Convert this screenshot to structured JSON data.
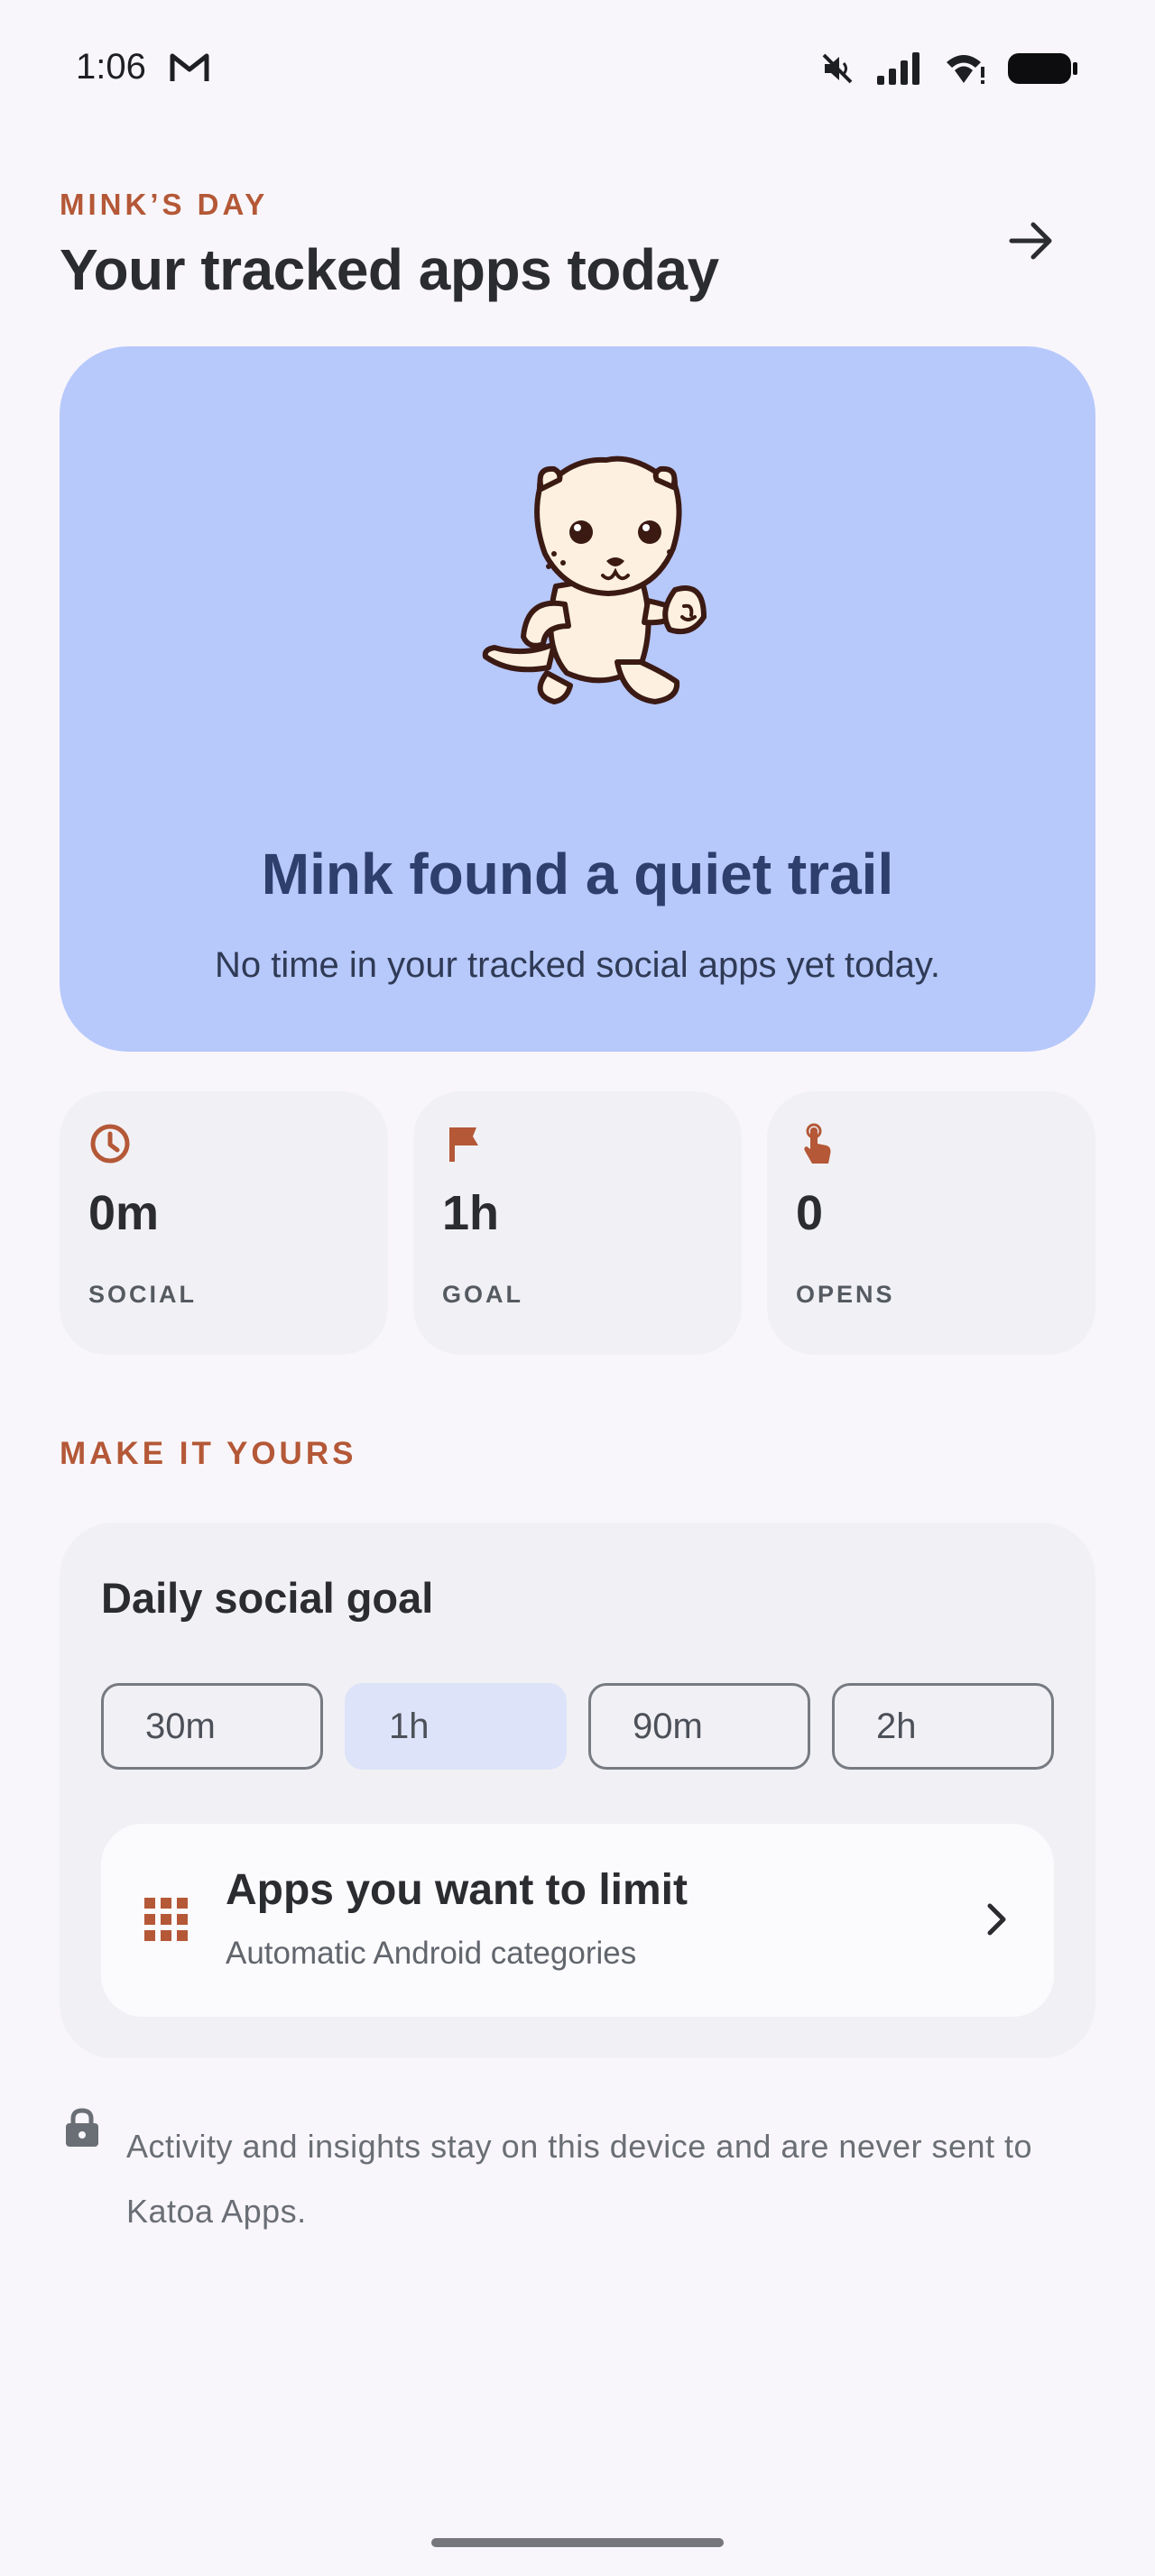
{
  "status_bar": {
    "time": "1:06",
    "icons": [
      "gmail-icon",
      "mute-icon",
      "signal-icon",
      "wifi-icon",
      "battery-icon"
    ]
  },
  "header": {
    "eyebrow": "MINK’S DAY",
    "title": "Your tracked apps today",
    "next_icon": "arrow-right-icon"
  },
  "hero": {
    "title": "Mink found a quiet trail",
    "subtitle": "No time in your tracked social apps yet today.",
    "background": "#b7c8fb"
  },
  "stats": [
    {
      "icon": "clock-icon",
      "value": "0m",
      "label": "SOCIAL"
    },
    {
      "icon": "flag-icon",
      "value": "1h",
      "label": "GOAL"
    },
    {
      "icon": "tap-icon",
      "value": "0",
      "label": "OPENS"
    }
  ],
  "section": {
    "title": "MAKE IT YOURS"
  },
  "goal": {
    "title": "Daily social goal",
    "options": [
      "30m",
      "1h",
      "90m",
      "2h"
    ],
    "selected": "1h"
  },
  "apps_limit": {
    "title": "Apps you want to limit",
    "subtitle": "Automatic Android categories"
  },
  "privacy": {
    "text": "Activity and insights stay on this device and are never sent to Katoa Apps."
  },
  "colors": {
    "accent": "#b45837",
    "hero_bg": "#b7c8fb",
    "hero_title": "#2e3f6d",
    "selected_chip": "#dde3f8"
  }
}
